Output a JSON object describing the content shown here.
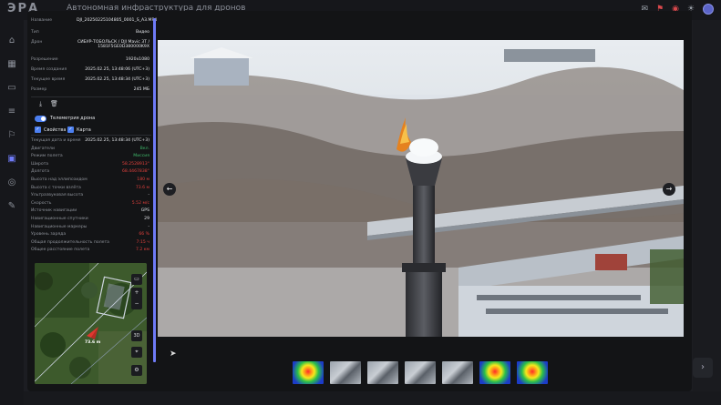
{
  "app": {
    "logo": "ЭРА",
    "title": "Автономная инфраструктура для дронов"
  },
  "topbar_icons": [
    "mail-icon",
    "bell-icon",
    "alert-icon",
    "sun-icon",
    "avatar"
  ],
  "sidebar": [
    "home-icon",
    "grid-icon",
    "monitor-icon",
    "list-icon",
    "flag-icon",
    "media-icon",
    "globe-icon",
    "tools-icon"
  ],
  "info": {
    "name_label": "Название",
    "name_value": "DJI_20250225104805_0001_S_A3.MP4",
    "type_label": "Тип",
    "type_value": "Видео",
    "drone_label": "Дрон",
    "drone_value": "СИБУР-ТОБОЛЬСК / DJI Mavic 3T / 1581F5GE0D380000K9X",
    "resolution_label": "Разрешение",
    "resolution_value": "1920x1080",
    "created_label": "Время создания",
    "created_value": "2025.02.25, 13:48:06 (UTC+3)",
    "current_time_label": "Текущее время",
    "current_time_value": "2025.02.25, 13:48:34 (UTC+3)",
    "size_label": "Размер",
    "size_value": "245 МБ"
  },
  "telemetry": {
    "toggle_label": "Телеметрия дрона",
    "properties_label": "Свойства",
    "map_label": "Карта",
    "rows": [
      {
        "k": "Текущая дата и время",
        "v": "2025.02.25, 13:48:34 (UTC+3)",
        "c": ""
      },
      {
        "k": "Двигатели",
        "v": "Вкл.",
        "c": "green"
      },
      {
        "k": "Режим полета",
        "v": "Миссия",
        "c": "green"
      },
      {
        "k": "Широта",
        "v": "58.2528913°",
        "c": "red"
      },
      {
        "k": "Долгота",
        "v": "68.4467838°",
        "c": "red"
      },
      {
        "k": "Высота над эллипсоидом",
        "v": "180 м",
        "c": "red"
      },
      {
        "k": "Высота с точки взлёта",
        "v": "73.6 м",
        "c": "red"
      },
      {
        "k": "Ультразвуковая высота",
        "v": "-",
        "c": ""
      },
      {
        "k": "Скорость",
        "v": "5.52 м/с",
        "c": "red"
      },
      {
        "k": "Источник навигации",
        "v": "GPS",
        "c": ""
      },
      {
        "k": "Навигационные спутники",
        "v": "29",
        "c": ""
      },
      {
        "k": "Навигационные маркеры",
        "v": "-",
        "c": ""
      },
      {
        "k": "Уровень заряда",
        "v": "66 %",
        "c": "red"
      },
      {
        "k": "Общая продолжительность полета",
        "v": "7:15 ч",
        "c": "red"
      },
      {
        "k": "Общее расстояние полета",
        "v": "7.2 км",
        "c": "red"
      }
    ]
  },
  "map": {
    "threed_label": "3D",
    "marker_text": "73.6 m"
  },
  "media": {
    "prev_icon": "arrow-left-icon",
    "next_icon": "arrow-right-icon"
  },
  "thumbnails": [
    "thermal",
    "visual",
    "visual",
    "visual",
    "visual",
    "thermal",
    "thermal"
  ]
}
